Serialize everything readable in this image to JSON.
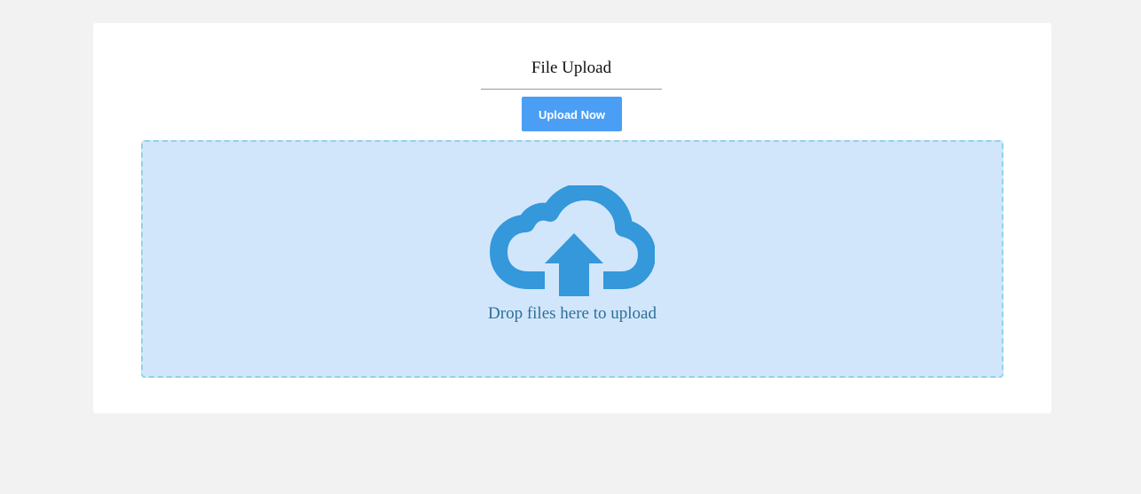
{
  "upload": {
    "title": "File Upload",
    "button_label": "Upload Now",
    "dropzone_text": "Drop files here to upload",
    "icon": "cloud-upload-icon"
  },
  "colors": {
    "page_background": "#f2f2f2",
    "card_background": "#ffffff",
    "button_background": "#4a9ff5",
    "dropzone_background": "#d2e6fb",
    "dropzone_border": "#90d3e6",
    "icon_color": "#3498db",
    "dropzone_text": "#2d6f99"
  }
}
